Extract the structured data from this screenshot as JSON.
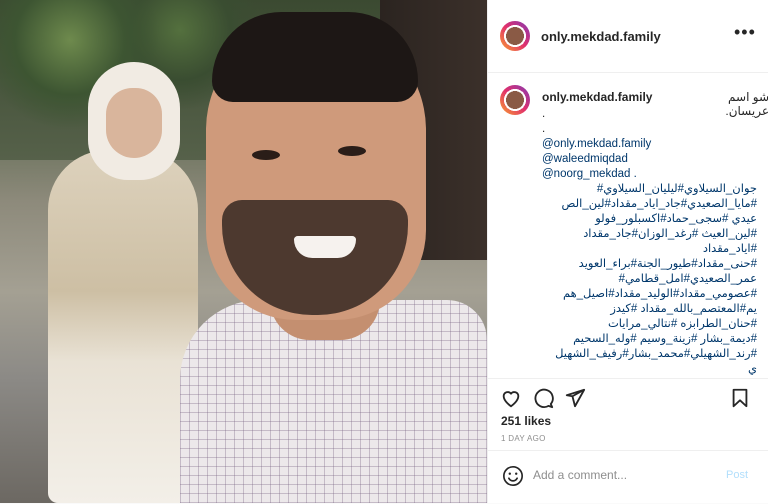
{
  "post": {
    "username": "only.mekdad.family",
    "more_icon": "ellipsis-icon",
    "caption_user": "only.mekdad.family",
    "caption_first": "شو اسم عريسان.",
    "caption_dots": [
      ".",
      "."
    ],
    "caption_mentions": [
      "@only.mekdad.family",
      "@waleedmiqdad",
      "@noorg_mekdad ."
    ],
    "caption_hashtags": [
      "جوان_السيلاوي#ليليان_السيلاوي#",
      "#مايا_الصعيدي#جاد_اياد_مقداد#لين_الص",
      "عيدي #سجى_حماد#اكسبلور_فولو",
      "#لين_العيث #رغد_الوزان#جاد_مقداد",
      "#اياد_مقداد",
      "#حنى_مقداد#طيور_الجنة#براء_العويد",
      "عمر_الصعيدي#امل_قطامي#",
      "#عصومي_مقداد#الوليد_مقداد#اصيل_هم",
      "يم#المعتصم_بالله_مقداد #كيدز",
      "#حنان_الطرابزه #نتالي_مرايات",
      "#ديمة_بشار #زينة_وسيم #وله_السحيم",
      "#رند_الشهيلي#محمد_بشار#رفيف_الشهيل",
      "ي"
    ],
    "likes": "251 likes",
    "time_ago": "1 DAY AGO",
    "comment_placeholder": "Add a comment...",
    "post_button": "Post",
    "icons": [
      "heart-icon",
      "comment-icon",
      "share-icon",
      "bookmark-icon",
      "emoji-icon"
    ]
  }
}
